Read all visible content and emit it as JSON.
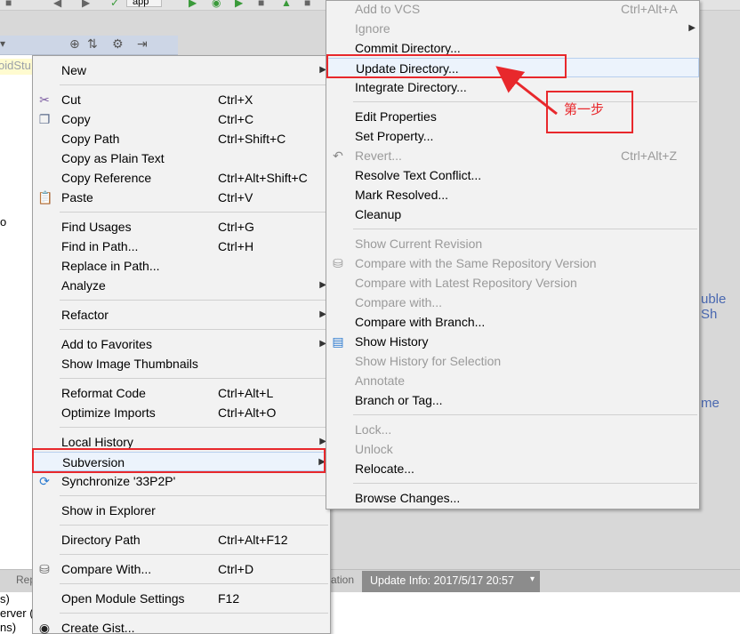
{
  "toolbar": {
    "run_config": "app"
  },
  "project_panel": {
    "tree_fragment": "oidStu",
    "side_fragment": "o"
  },
  "background_fragments": {
    "right_a": "uble Sh",
    "right_b": "me"
  },
  "bottom_bar": {
    "tab_left_a": "",
    "tab_left_b": "Rep",
    "tab_middle": "ation",
    "update_info": "Update Info: 2017/5/17 20:57"
  },
  "bottom_panel": {
    "lines": [
      "s)",
      "erver (",
      "ns)"
    ]
  },
  "context_menu": {
    "items": [
      {
        "label": "New",
        "shortcut": "",
        "submenu": true,
        "icon": ""
      },
      {
        "label": "Cut",
        "shortcut": "Ctrl+X",
        "submenu": false,
        "icon": "scissors-icon"
      },
      {
        "label": "Copy",
        "shortcut": "Ctrl+C",
        "submenu": false,
        "icon": "copy-icon"
      },
      {
        "label": "Copy Path",
        "shortcut": "Ctrl+Shift+C",
        "submenu": false,
        "icon": ""
      },
      {
        "label": "Copy as Plain Text",
        "shortcut": "",
        "submenu": false,
        "icon": ""
      },
      {
        "label": "Copy Reference",
        "shortcut": "Ctrl+Alt+Shift+C",
        "submenu": false,
        "icon": ""
      },
      {
        "label": "Paste",
        "shortcut": "Ctrl+V",
        "submenu": false,
        "icon": "paste-icon"
      },
      {
        "label": "Find Usages",
        "shortcut": "Ctrl+G",
        "submenu": false,
        "icon": ""
      },
      {
        "label": "Find in Path...",
        "shortcut": "Ctrl+H",
        "submenu": false,
        "icon": ""
      },
      {
        "label": "Replace in Path...",
        "shortcut": "",
        "submenu": false,
        "icon": ""
      },
      {
        "label": "Analyze",
        "shortcut": "",
        "submenu": true,
        "icon": ""
      },
      {
        "label": "Refactor",
        "shortcut": "",
        "submenu": true,
        "icon": ""
      },
      {
        "label": "Add to Favorites",
        "shortcut": "",
        "submenu": true,
        "icon": ""
      },
      {
        "label": "Show Image Thumbnails",
        "shortcut": "",
        "submenu": false,
        "icon": ""
      },
      {
        "label": "Reformat Code",
        "shortcut": "Ctrl+Alt+L",
        "submenu": false,
        "icon": ""
      },
      {
        "label": "Optimize Imports",
        "shortcut": "Ctrl+Alt+O",
        "submenu": false,
        "icon": ""
      },
      {
        "label": "Local History",
        "shortcut": "",
        "submenu": true,
        "icon": ""
      },
      {
        "label": "Subversion",
        "shortcut": "",
        "submenu": true,
        "icon": ""
      },
      {
        "label": "Synchronize '33P2P'",
        "shortcut": "",
        "submenu": false,
        "icon": "sync-icon"
      },
      {
        "label": "Show in Explorer",
        "shortcut": "",
        "submenu": false,
        "icon": ""
      },
      {
        "label": "Directory Path",
        "shortcut": "Ctrl+Alt+F12",
        "submenu": false,
        "icon": ""
      },
      {
        "label": "Compare With...",
        "shortcut": "Ctrl+D",
        "submenu": false,
        "icon": "compare-icon"
      },
      {
        "label": "Open Module Settings",
        "shortcut": "F12",
        "submenu": false,
        "icon": ""
      },
      {
        "label": "Create Gist...",
        "shortcut": "",
        "submenu": false,
        "icon": "github-icon"
      }
    ]
  },
  "svn_menu": {
    "items": [
      {
        "label": "Add to VCS",
        "shortcut": "Ctrl+Alt+A",
        "disabled": true,
        "submenu": false,
        "icon": ""
      },
      {
        "label": "Ignore",
        "shortcut": "",
        "disabled": true,
        "submenu": true,
        "icon": ""
      },
      {
        "label": "Commit Directory...",
        "shortcut": "",
        "disabled": false,
        "submenu": false,
        "icon": ""
      },
      {
        "label": "Update Directory...",
        "shortcut": "",
        "disabled": false,
        "submenu": false,
        "icon": ""
      },
      {
        "label": "Integrate Directory...",
        "shortcut": "",
        "disabled": false,
        "submenu": false,
        "icon": ""
      },
      {
        "label": "Edit Properties",
        "shortcut": "",
        "disabled": false,
        "submenu": false,
        "icon": ""
      },
      {
        "label": "Set Property...",
        "shortcut": "",
        "disabled": false,
        "submenu": false,
        "icon": ""
      },
      {
        "label": "Revert...",
        "shortcut": "Ctrl+Alt+Z",
        "disabled": true,
        "submenu": false,
        "icon": "revert-icon"
      },
      {
        "label": "Resolve Text Conflict...",
        "shortcut": "",
        "disabled": false,
        "submenu": false,
        "icon": ""
      },
      {
        "label": "Mark Resolved...",
        "shortcut": "",
        "disabled": false,
        "submenu": false,
        "icon": ""
      },
      {
        "label": "Cleanup",
        "shortcut": "",
        "disabled": false,
        "submenu": false,
        "icon": ""
      },
      {
        "label": "Show Current Revision",
        "shortcut": "",
        "disabled": true,
        "submenu": false,
        "icon": ""
      },
      {
        "label": "Compare with the Same Repository Version",
        "shortcut": "",
        "disabled": true,
        "submenu": false,
        "icon": "compare-icon"
      },
      {
        "label": "Compare with Latest Repository Version",
        "shortcut": "",
        "disabled": true,
        "submenu": false,
        "icon": ""
      },
      {
        "label": "Compare with...",
        "shortcut": "",
        "disabled": true,
        "submenu": false,
        "icon": ""
      },
      {
        "label": "Compare with Branch...",
        "shortcut": "",
        "disabled": false,
        "submenu": false,
        "icon": ""
      },
      {
        "label": "Show History",
        "shortcut": "",
        "disabled": false,
        "submenu": false,
        "icon": "history-icon"
      },
      {
        "label": "Show History for Selection",
        "shortcut": "",
        "disabled": true,
        "submenu": false,
        "icon": ""
      },
      {
        "label": "Annotate",
        "shortcut": "",
        "disabled": true,
        "submenu": false,
        "icon": ""
      },
      {
        "label": "Branch or Tag...",
        "shortcut": "",
        "disabled": false,
        "submenu": false,
        "icon": ""
      },
      {
        "label": "Lock...",
        "shortcut": "",
        "disabled": true,
        "submenu": false,
        "icon": ""
      },
      {
        "label": "Unlock",
        "shortcut": "",
        "disabled": true,
        "submenu": false,
        "icon": ""
      },
      {
        "label": "Relocate...",
        "shortcut": "",
        "disabled": false,
        "submenu": false,
        "icon": ""
      },
      {
        "label": "Browse Changes...",
        "shortcut": "",
        "disabled": false,
        "submenu": false,
        "icon": ""
      }
    ]
  },
  "annotation": {
    "step_label": "第一步",
    "color": "#e8282c"
  },
  "colors": {
    "menu_bg": "#f2f2f2",
    "disabled_text": "#9a9a9a",
    "hover_bg": "#ecf3fc",
    "status_bg": "#8c8c8c"
  }
}
